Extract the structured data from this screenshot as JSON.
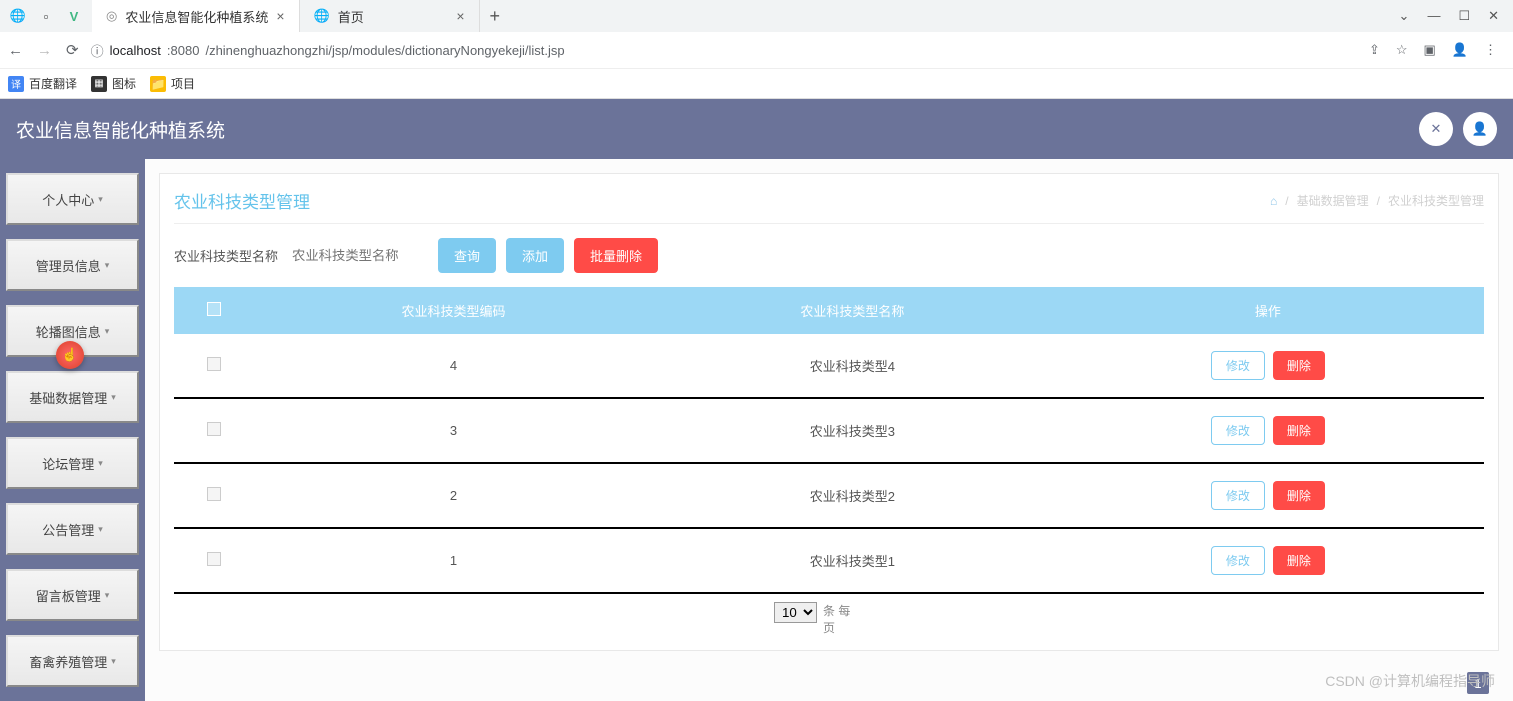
{
  "browser": {
    "tabs": [
      {
        "title": "农业信息智能化种植系统",
        "active": true
      },
      {
        "title": "首页",
        "active": false
      }
    ],
    "url_host": "localhost",
    "url_port": ":8080",
    "url_path": "/zhinenghuazhongzhi/jsp/modules/dictionaryNongyekeji/list.jsp",
    "bookmarks": [
      {
        "label": "百度翻译",
        "color": "#4285f4"
      },
      {
        "label": "图标",
        "color": "#333"
      },
      {
        "label": "项目",
        "color": "#fbbc04"
      }
    ]
  },
  "app": {
    "title": "农业信息智能化种植系统"
  },
  "sidebar": {
    "items": [
      {
        "label": "个人中心"
      },
      {
        "label": "管理员信息"
      },
      {
        "label": "轮播图信息"
      },
      {
        "label": "基础数据管理"
      },
      {
        "label": "论坛管理"
      },
      {
        "label": "公告管理"
      },
      {
        "label": "留言板管理"
      },
      {
        "label": "畜禽养殖管理"
      }
    ]
  },
  "panel": {
    "title": "农业科技类型管理",
    "breadcrumb": [
      "基础数据管理",
      "农业科技类型管理"
    ]
  },
  "filter": {
    "label": "农业科技类型名称",
    "placeholder": "农业科技类型名称",
    "search_btn": "查询",
    "add_btn": "添加",
    "bulk_delete_btn": "批量删除"
  },
  "table": {
    "columns": [
      "",
      "农业科技类型编码",
      "农业科技类型名称",
      "操作"
    ],
    "rows": [
      {
        "code": "4",
        "name": "农业科技类型4"
      },
      {
        "code": "3",
        "name": "农业科技类型3"
      },
      {
        "code": "2",
        "name": "农业科技类型2"
      },
      {
        "code": "1",
        "name": "农业科技类型1"
      }
    ],
    "edit_btn": "修改",
    "delete_btn": "删除"
  },
  "pagination": {
    "page_size": "10",
    "per_page_text_1": "条 每",
    "per_page_text_2": "页",
    "current_page": "1"
  },
  "watermark": "CSDN @计算机编程指导师"
}
